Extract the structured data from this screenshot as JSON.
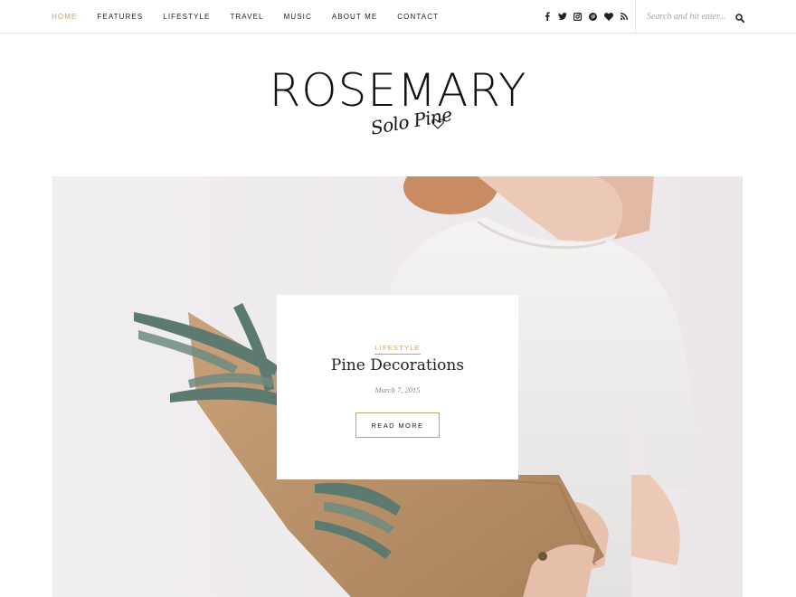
{
  "nav": {
    "items": [
      "HOME",
      "FEATURES",
      "LIFESTYLE",
      "TRAVEL",
      "MUSIC",
      "ABOUT ME",
      "CONTACT"
    ],
    "active_index": 0,
    "active_color": "#c69f73"
  },
  "social": [
    "facebook-icon",
    "twitter-icon",
    "instagram-icon",
    "pinterest-icon",
    "bloglovin-heart-icon",
    "rss-icon"
  ],
  "search": {
    "placeholder": "Search and hit enter...",
    "value": ""
  },
  "logo": {
    "title": "ROSEMARY",
    "subtitle": "Solo Pine"
  },
  "post": {
    "category": "LIFESTYLE",
    "title": "Pine Decorations",
    "date": "March 7, 2015",
    "button_label": "READ MORE"
  },
  "colors": {
    "accent": "#c69f73",
    "text": "#222222",
    "border": "#e9e9e9"
  }
}
